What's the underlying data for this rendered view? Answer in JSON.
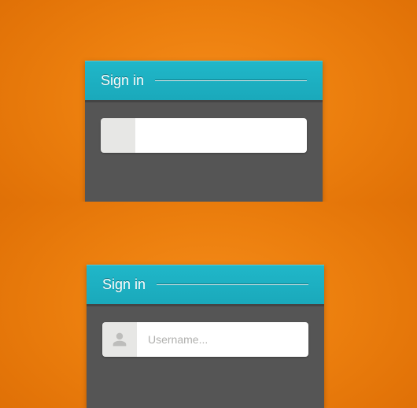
{
  "top": {
    "header_title": "Sign in",
    "username_value": "",
    "username_placeholder": ""
  },
  "bottom": {
    "header_title": "Sign in",
    "username_value": "",
    "username_placeholder": "Username..."
  },
  "colors": {
    "accent": "#1aa9bb",
    "background": "#e3780c",
    "panel": "#555555"
  }
}
